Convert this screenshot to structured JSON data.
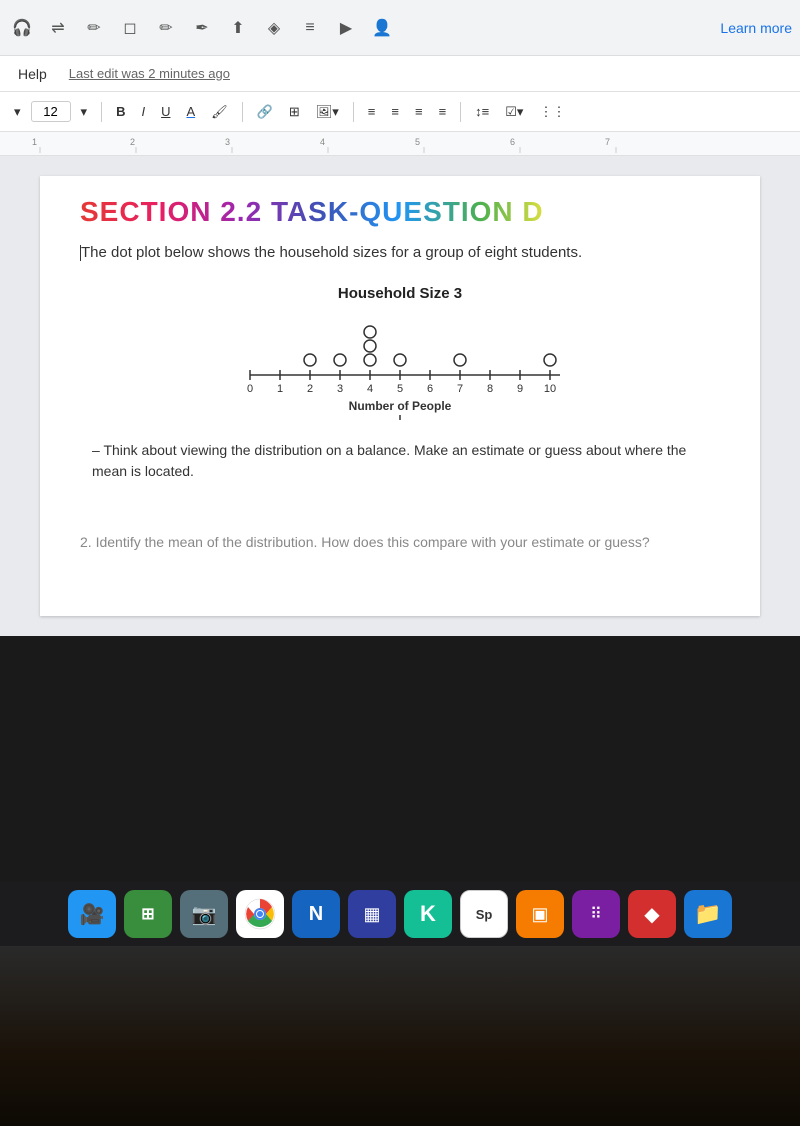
{
  "toolbar": {
    "learn_more": "Learn more",
    "icons": [
      "headphones",
      "shuffle",
      "pencil",
      "eraser",
      "pencil2",
      "pen",
      "upload",
      "diamond",
      "list",
      "play",
      "person"
    ]
  },
  "menu": {
    "help": "Help",
    "last_edit": "Last edit was 2 minutes ago"
  },
  "format_toolbar": {
    "font_size": "12",
    "bold": "B",
    "italic": "I",
    "underline": "U",
    "font_color": "A"
  },
  "document": {
    "section_title": "SECTION 2.2 TASK-QUESTION D",
    "intro_text": "The dot plot below shows the household sizes for a group of eight students.",
    "dot_plot_title": "Household Size 3",
    "x_axis_label": "Number of People",
    "x_axis_values": [
      "0",
      "1",
      "2",
      "3",
      "4",
      "5",
      "6",
      "7",
      "8",
      "9",
      "10"
    ],
    "dot_data": {
      "description": "Dots at positions: 2(1 dot), 3(1 dot), 4(3 dots stacked), 5(1 dot), 7(1 dot), 10(1 dot)",
      "positions": [
        2,
        3,
        4,
        4,
        4,
        5,
        7,
        10
      ]
    },
    "question1_prefix": "–",
    "question1_text": "Think about viewing the distribution on a balance. Make an estimate or guess about where the mean is located.",
    "question2_text": "2. Identify the mean of the distribution. How does this compare with your estimate or guess?"
  },
  "taskbar": {
    "icons": [
      {
        "name": "zoom",
        "color": "#2196F3",
        "symbol": "🎥"
      },
      {
        "name": "grid-app",
        "color": "#4CAF50",
        "symbol": "⊞"
      },
      {
        "name": "camera",
        "color": "#607D8B",
        "symbol": "📷"
      },
      {
        "name": "chrome",
        "color": "#EA4335",
        "symbol": "●"
      },
      {
        "name": "notes",
        "color": "#2196F3",
        "symbol": "N"
      },
      {
        "name": "app1",
        "color": "#3F51B5",
        "symbol": "▦"
      },
      {
        "name": "khan",
        "color": "#14BF96",
        "symbol": "K"
      },
      {
        "name": "sp-app",
        "color": "#fff",
        "symbol": "Sp"
      },
      {
        "name": "storage",
        "color": "#FFC107",
        "symbol": "▣"
      },
      {
        "name": "grid2",
        "color": "#9C27B0",
        "symbol": "⋮⋮"
      },
      {
        "name": "shape",
        "color": "#F44336",
        "symbol": "◆"
      },
      {
        "name": "folder",
        "color": "#1976D2",
        "symbol": "📁"
      }
    ]
  }
}
